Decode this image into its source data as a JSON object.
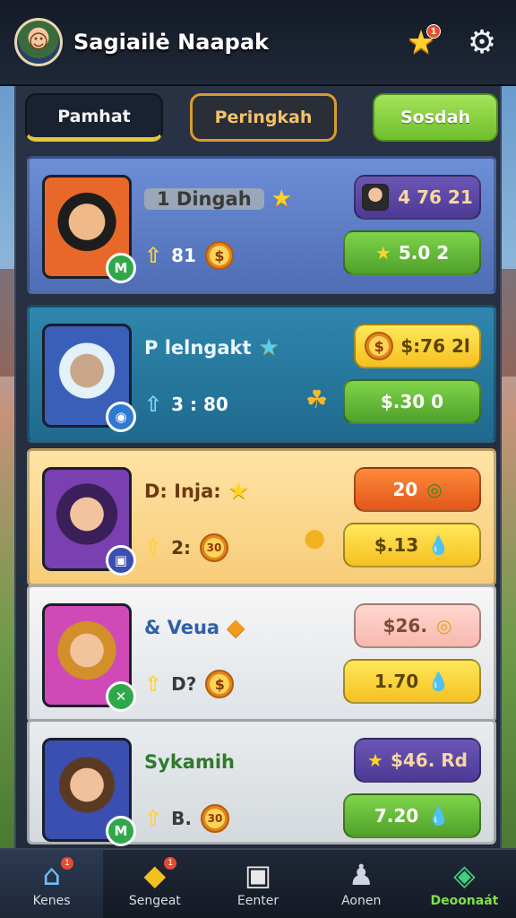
{
  "header": {
    "title": "Sagiailė Naapak",
    "notification_count": "1",
    "icons": {
      "avatar": "player-avatar",
      "star": "star-icon",
      "settings": "gear-icon"
    }
  },
  "tabs": [
    {
      "label": "Pamhat"
    },
    {
      "label": "Peringkah"
    },
    {
      "label": "Sosdah"
    }
  ],
  "rows": [
    {
      "name": "1 Dingah",
      "stat": "81",
      "top_value": "4 76 21",
      "bottom_value": "5.0 2",
      "badge": "M"
    },
    {
      "name": "P lelngakt",
      "stat": "3 : 80",
      "top_value": "$:76 2l",
      "bottom_value": "$.30 0"
    },
    {
      "name": "D: Inja:",
      "stat": "2:",
      "stat_coin": "30",
      "top_value": "20",
      "bottom_value": "$.13"
    },
    {
      "name": "& Veua",
      "stat": "D?",
      "top_value": "$26.",
      "bottom_value": "1.70"
    },
    {
      "name": "Sykamih",
      "stat": "B.",
      "stat_coin": "30",
      "top_value": "$46. Rd",
      "bottom_value": "7.20",
      "badge": "M"
    }
  ],
  "nav": [
    {
      "label": "Kenes",
      "icon": "home-icon",
      "badge": "1"
    },
    {
      "label": "Sengeat",
      "icon": "ticket-icon",
      "badge": "1"
    },
    {
      "label": "Eenter",
      "icon": "card-icon"
    },
    {
      "label": "Aonen",
      "icon": "friends-icon"
    },
    {
      "label": "Deoonaát",
      "icon": "gem-icon"
    }
  ],
  "colors": {
    "accent_yellow": "#e5c63a",
    "accent_green": "#6fbf2b",
    "panel_bg": "#283244"
  }
}
